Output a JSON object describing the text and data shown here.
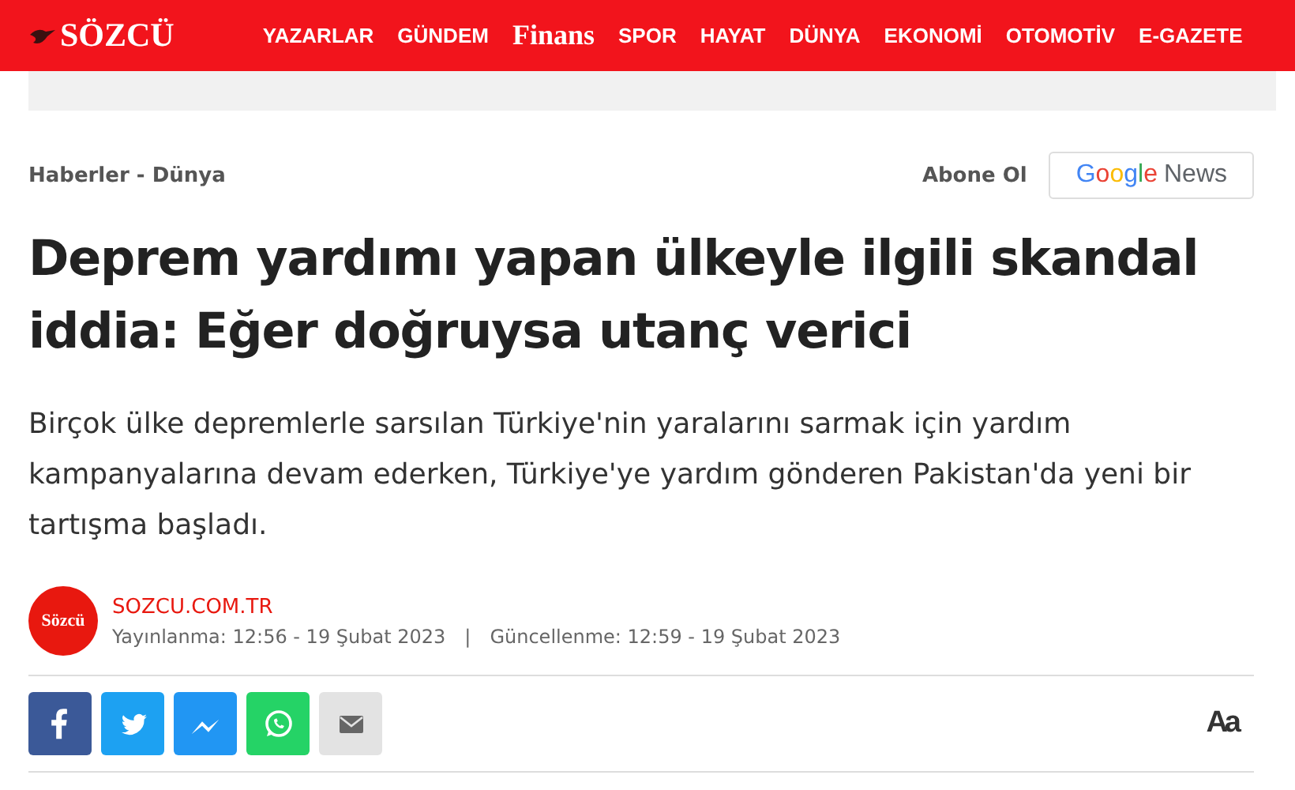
{
  "header": {
    "logo": "SÖZCÜ",
    "nav": [
      {
        "label": "YAZARLAR",
        "kind": "text"
      },
      {
        "label": "GÜNDEM",
        "kind": "text"
      },
      {
        "label": "Finans",
        "kind": "brand"
      },
      {
        "label": "SPOR",
        "kind": "text"
      },
      {
        "label": "HAYAT",
        "kind": "text"
      },
      {
        "label": "DÜNYA",
        "kind": "text"
      },
      {
        "label": "EKONOMİ",
        "kind": "text"
      },
      {
        "label": "OTOMOTİV",
        "kind": "text"
      },
      {
        "label": "E-GAZETE",
        "kind": "text"
      }
    ]
  },
  "breadcrumb": "Haberler - Dünya",
  "subscribe": {
    "label": "Abone Ol",
    "google": "Google",
    "news": "News"
  },
  "headline": "Deprem yardımı yapan ülkeyle ilgili skandal iddia: Eğer doğruysa utanç verici",
  "summary": "Birçok ülke depremlerle sarsılan Türkiye'nin yaralarını sarmak için yardım kampanyalarına devam ederken, Türkiye'ye yardım gönderen Pakistan'da yeni bir tartışma başladı.",
  "source": {
    "avatar": "Sözcü",
    "name": "SOZCU.COM.TR",
    "published": "Yayınlanma: 12:56 - 19 Şubat 2023",
    "separator": "|",
    "updated": "Güncellenme: 12:59 - 19 Şubat 2023"
  },
  "share": [
    {
      "kind": "facebook"
    },
    {
      "kind": "twitter"
    },
    {
      "kind": "messenger"
    },
    {
      "kind": "whatsapp"
    },
    {
      "kind": "email"
    }
  ],
  "font_size_button": "Aa"
}
